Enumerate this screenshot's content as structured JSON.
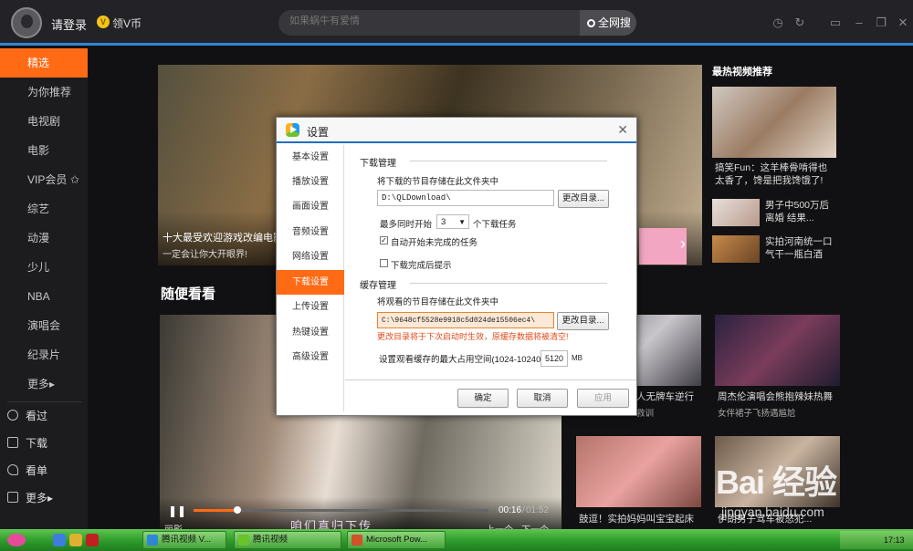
{
  "header": {
    "login": "请登录",
    "vcoin": "领V币",
    "search_placeholder": "如果蜗牛有爱情",
    "search_button": "全网搜"
  },
  "sidebar": {
    "items": [
      "精选",
      "为你推荐",
      "电视剧",
      "电影",
      "VIP会员",
      "综艺",
      "动漫",
      "少儿",
      "NBA",
      "演唱会",
      "纪录片",
      "更多▸"
    ],
    "bottom": [
      "看过",
      "下载",
      "看单",
      "更多▸"
    ]
  },
  "banner": {
    "title": "十大最受欢迎游戏改编电影",
    "subtitle": "一定会让你大开眼界!"
  },
  "hot": {
    "title": "最热视频推荐",
    "item1": "搞笑Fun：这羊棒骨啃得也太香了，馋是把我馋饿了!",
    "item2": "男子中500万后离婚 结果...",
    "item3": "实拍河南统一口气干一瓶白酒"
  },
  "section_title": "随便看看",
  "player": {
    "time_current": "00:16",
    "time_total": "01:52",
    "subtitle": "咱们真归下传",
    "progress": 0.15,
    "prev": "上一个",
    "next": "下一个",
    "caption": "丽影"
  },
  "tiles": {
    "t1_title": "人无牌车逆行",
    "t1_sub": "救训",
    "t2_title": "周杰伦演唱会熊抱辣妹热舞",
    "t2_sub": "女伴裙子飞扬遇尴尬",
    "t3_title": "鼓逗！实拍妈妈叫宝宝起床",
    "t4_title": "伊朗男子驾车被怒犯..."
  },
  "dialog": {
    "title": "设置",
    "close": "✕",
    "tabs": [
      "基本设置",
      "播放设置",
      "画面设置",
      "音频设置",
      "网络设置",
      "下载设置",
      "上传设置",
      "热键设置",
      "高级设置"
    ],
    "download_group": "下载管理",
    "download_label": "将下载的节目存储在此文件夹中",
    "download_path": "D:\\QLDownload\\",
    "change_dir": "更改目录...",
    "concurrent_prefix": "最多同时开始",
    "concurrent_value": "3",
    "concurrent_suffix": "个下载任务",
    "auto_start": "自动开始未完成的任务",
    "finish_prompt": "下载完成后提示",
    "cache_group": "缓存管理",
    "cache_label": "将观看的节目存储在此文件夹中",
    "cache_path": "C:\\9648cf5528e9918c5d024de15506ec4\\",
    "cache_warning": "更改目录将于下次启动时生效，原缓存数据将被清空!",
    "cache_size_label": "设置观看缓存的最大占用空间(1024-10240)",
    "cache_size_value": "5120",
    "cache_unit": "MB",
    "ok": "确定",
    "cancel": "取消",
    "apply": "应用"
  },
  "taskbar": {
    "btn1": "腾讯视频 V...",
    "btn2": "腾讯视频",
    "btn3": "Microsoft Pow...",
    "clock": "17:13"
  },
  "watermark": {
    "logo": "Bai 经验",
    "url": "jingyan.baidu.com"
  }
}
